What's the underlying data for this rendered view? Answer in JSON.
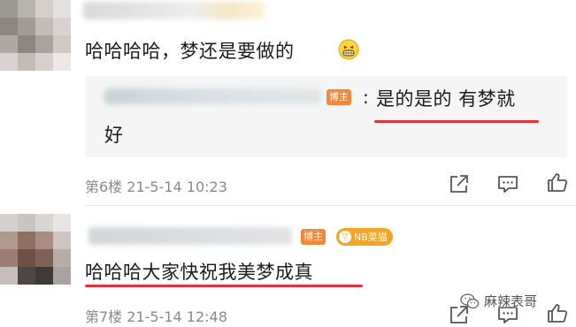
{
  "comments": [
    {
      "text": "哈哈哈哈，梦还是要做的",
      "emoji": "grinning-face-emoji",
      "reply": {
        "badge": "博主",
        "colon": ":",
        "text_line1": "是的是的 有梦就",
        "text_line2": "好"
      },
      "meta": "第6楼  21-5-14 10:23"
    },
    {
      "badge": "博主",
      "fan_badge": "NB菜猫",
      "text": "哈哈哈大家快祝我美梦成真",
      "meta": "第7楼  21-5-14 12:48"
    }
  ],
  "actions": {
    "icons": [
      "share-icon",
      "comment-icon",
      "like-icon"
    ]
  },
  "watermark": {
    "text": "麻辣表哥"
  },
  "colors": {
    "accent_red": "#e0323a",
    "badge_orange": "#f08a3a",
    "fan_badge": "#f5a524",
    "meta_gray": "#8a8a8a"
  }
}
